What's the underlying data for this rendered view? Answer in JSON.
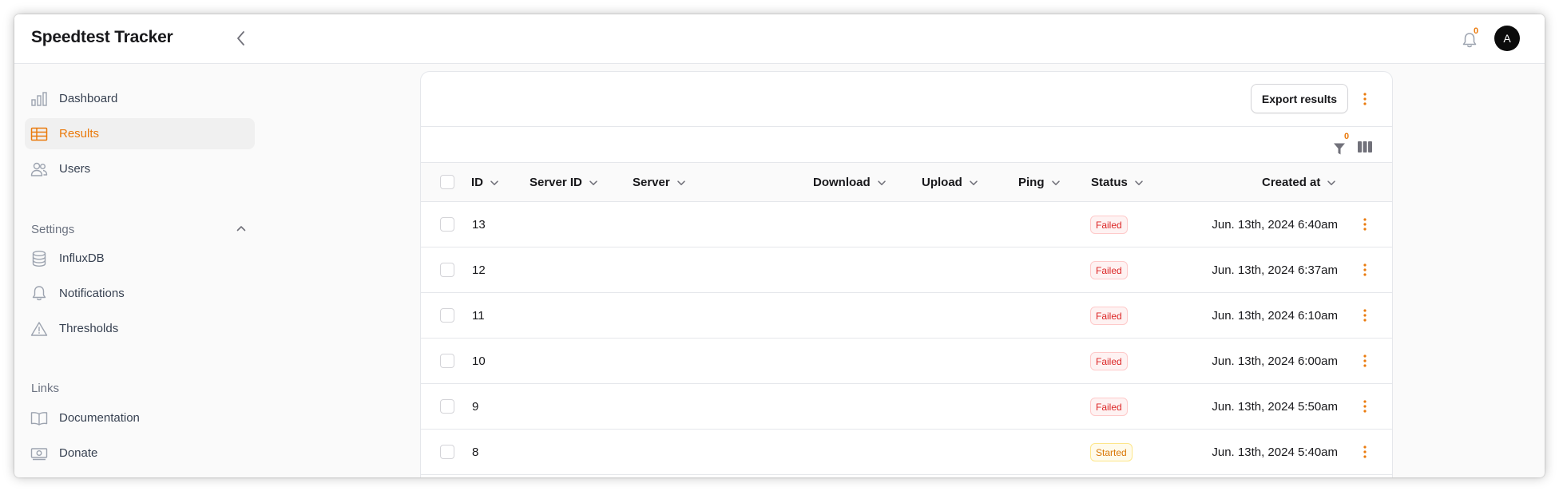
{
  "app": {
    "title": "Speedtest Tracker"
  },
  "header": {
    "notifications_count": "0",
    "avatar_initial": "A"
  },
  "sidebar": {
    "main_items": [
      {
        "label": "Dashboard",
        "icon": "bar-chart-icon"
      },
      {
        "label": "Results",
        "icon": "table-icon",
        "active": true
      },
      {
        "label": "Users",
        "icon": "users-icon"
      }
    ],
    "settings": {
      "title": "Settings",
      "items": [
        {
          "label": "InfluxDB",
          "icon": "database-icon"
        },
        {
          "label": "Notifications",
          "icon": "bell-icon"
        },
        {
          "label": "Thresholds",
          "icon": "warning-icon"
        }
      ]
    },
    "links": {
      "title": "Links",
      "items": [
        {
          "label": "Documentation",
          "icon": "book-icon"
        },
        {
          "label": "Donate",
          "icon": "banknote-icon"
        }
      ]
    }
  },
  "toolbar": {
    "export_label": "Export results",
    "filter_count": "0"
  },
  "table": {
    "columns": [
      "ID",
      "Server ID",
      "Server",
      "Download",
      "Upload",
      "Ping",
      "Status",
      "Created at"
    ],
    "rows": [
      {
        "id": "13",
        "status": "Failed",
        "created_at": "Jun. 13th, 2024 6:40am"
      },
      {
        "id": "12",
        "status": "Failed",
        "created_at": "Jun. 13th, 2024 6:37am"
      },
      {
        "id": "11",
        "status": "Failed",
        "created_at": "Jun. 13th, 2024 6:10am"
      },
      {
        "id": "10",
        "status": "Failed",
        "created_at": "Jun. 13th, 2024 6:00am"
      },
      {
        "id": "9",
        "status": "Failed",
        "created_at": "Jun. 13th, 2024 5:50am"
      },
      {
        "id": "8",
        "status": "Started",
        "created_at": "Jun. 13th, 2024 5:40am"
      }
    ]
  },
  "colors": {
    "accent": "#ea7a0c",
    "failed": "#dc2626",
    "started": "#d97706"
  }
}
